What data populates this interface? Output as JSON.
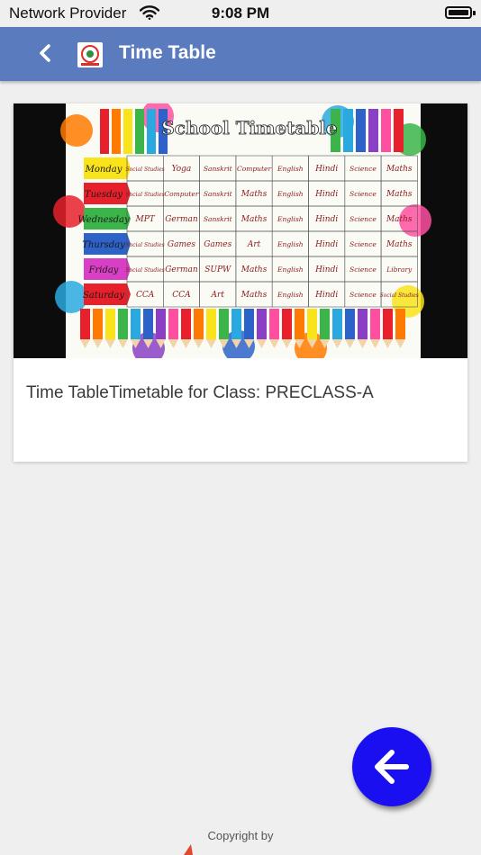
{
  "status_bar": {
    "carrier": "Network Provider",
    "time": "9:08 PM"
  },
  "header": {
    "title": "Time Table",
    "back_icon": "chevron-left-icon",
    "logo_icon": "school-logo-icon",
    "background_color": "#5a7cbe"
  },
  "card": {
    "caption": "Time TableTimetable for Class: PRECLASS-A",
    "image": {
      "title": "School Timetable",
      "days": [
        "Monday",
        "Tuesday",
        "Wednesday",
        "Thursday",
        "Friday",
        "Saturday"
      ],
      "rows": [
        [
          "Social Studies",
          "Yoga",
          "Sanskrit",
          "Computer",
          "English",
          "Hindi",
          "Science",
          "Maths"
        ],
        [
          "Social Studies",
          "Computer",
          "Sanskrit",
          "Maths",
          "English",
          "Hindi",
          "Science",
          "Maths"
        ],
        [
          "MPT",
          "German",
          "Sanskrit",
          "Maths",
          "English",
          "Hindi",
          "Science",
          "Maths"
        ],
        [
          "Social Studies",
          "Games",
          "Games",
          "Art",
          "English",
          "Hindi",
          "Science",
          "Maths"
        ],
        [
          "Social Studies",
          "German",
          "SUPW",
          "Maths",
          "English",
          "Hindi",
          "Science",
          "Library"
        ],
        [
          "CCA",
          "CCA",
          "Art",
          "Maths",
          "English",
          "Hindi",
          "Science",
          "Social Studies"
        ]
      ],
      "day_colors": [
        "#f9e31b",
        "#e8202b",
        "#3bb54a",
        "#2d63c8",
        "#d93fc4",
        "#e8202b"
      ]
    }
  },
  "fab": {
    "icon": "arrow-left-icon",
    "color": "#1a0ff0"
  },
  "footer": {
    "copyright": "Copyright by"
  }
}
